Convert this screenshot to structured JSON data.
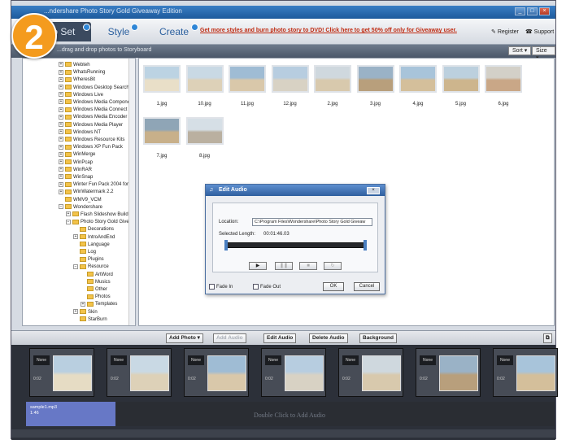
{
  "step_number": "2",
  "window": {
    "title": "...ndershare Photo Story Gold Giveaway Edition"
  },
  "nav": {
    "tabs": [
      {
        "label": "Photo Set"
      },
      {
        "label": "Style"
      },
      {
        "label": "Create"
      }
    ],
    "promo": "Get more styles and burn photo story to DVD! Click here to get 50% off only for Giveaway user.",
    "register": "Register",
    "support": "Support"
  },
  "toolbar": {
    "instruction": "...drag and drop photos to Storyboard",
    "sort": "Sort ▾",
    "size": "Size ▾"
  },
  "tree": [
    {
      "label": "Webteh",
      "level": 0,
      "exp": "+"
    },
    {
      "label": "WhatsRunning",
      "level": 0,
      "exp": "+"
    },
    {
      "label": "Wheres8it",
      "level": 0,
      "exp": "+"
    },
    {
      "label": "Windows Desktop Search",
      "level": 0,
      "exp": "+"
    },
    {
      "label": "Windows Live",
      "level": 0,
      "exp": "+"
    },
    {
      "label": "Windows Media Compone",
      "level": 0,
      "exp": "+"
    },
    {
      "label": "Windows Media Connect",
      "level": 0,
      "exp": "+"
    },
    {
      "label": "Windows Media Encoder",
      "level": 0,
      "exp": "+"
    },
    {
      "label": "Windows Media Player",
      "level": 0,
      "exp": "+"
    },
    {
      "label": "Windows NT",
      "level": 0,
      "exp": "+"
    },
    {
      "label": "Windows Resource Kits",
      "level": 0,
      "exp": "+"
    },
    {
      "label": "Windows XP Fun Pack",
      "level": 0,
      "exp": "+"
    },
    {
      "label": "WinMerge",
      "level": 0,
      "exp": "+"
    },
    {
      "label": "WinPcap",
      "level": 0,
      "exp": "+"
    },
    {
      "label": "WinRAR",
      "level": 0,
      "exp": "+"
    },
    {
      "label": "WinSnap",
      "level": 0,
      "exp": "+"
    },
    {
      "label": "Winter Fun Pack 2004 for",
      "level": 0,
      "exp": "+"
    },
    {
      "label": "WinWatermark 2.2",
      "level": 0,
      "exp": "+"
    },
    {
      "label": "WMV9_VCM",
      "level": 0,
      "exp": ""
    },
    {
      "label": "Wondershare",
      "level": 0,
      "exp": "−"
    },
    {
      "label": "Flash Slideshow Build",
      "level": 1,
      "exp": "+"
    },
    {
      "label": "Photo Story Gold Give",
      "level": 1,
      "exp": "−"
    },
    {
      "label": "Decorations",
      "level": 2,
      "exp": ""
    },
    {
      "label": "IntroAndEnd",
      "level": 2,
      "exp": "+"
    },
    {
      "label": "Language",
      "level": 2,
      "exp": ""
    },
    {
      "label": "Log",
      "level": 2,
      "exp": ""
    },
    {
      "label": "Plugins",
      "level": 2,
      "exp": ""
    },
    {
      "label": "Resource",
      "level": 2,
      "exp": "−"
    },
    {
      "label": "ArtWord",
      "level": 3,
      "exp": ""
    },
    {
      "label": "Musics",
      "level": 3,
      "exp": ""
    },
    {
      "label": "Other",
      "level": 3,
      "exp": ""
    },
    {
      "label": "Photos",
      "level": 3,
      "exp": ""
    },
    {
      "label": "Templates",
      "level": 3,
      "exp": "+"
    },
    {
      "label": "Skin",
      "level": 2,
      "exp": "+"
    },
    {
      "label": "StarBurn",
      "level": 2,
      "exp": ""
    }
  ],
  "thumbnails": [
    {
      "label": "1.jpg",
      "colors": [
        "#bcd3e3",
        "#e9dfc8"
      ]
    },
    {
      "label": "10.jpg",
      "colors": [
        "#c9d9e4",
        "#ddd1b8"
      ]
    },
    {
      "label": "11.jpg",
      "colors": [
        "#9fbcd4",
        "#d9c8aa"
      ]
    },
    {
      "label": "12.jpg",
      "colors": [
        "#b7cde0",
        "#d8d2c4"
      ]
    },
    {
      "label": "2.jpg",
      "colors": [
        "#cfd8de",
        "#d8c9ad"
      ]
    },
    {
      "label": "3.jpg",
      "colors": [
        "#9ab2c6",
        "#b89f7c"
      ]
    },
    {
      "label": "4.jpg",
      "colors": [
        "#a8c4da",
        "#d4bf9b"
      ]
    },
    {
      "label": "5.jpg",
      "colors": [
        "#bcd0de",
        "#cdb58d"
      ]
    },
    {
      "label": "6.jpg",
      "colors": [
        "#d3d0c8",
        "#c9a787"
      ]
    },
    {
      "label": "7.jpg",
      "colors": [
        "#8fa5b6",
        "#c8b08a"
      ]
    },
    {
      "label": "8.jpg",
      "colors": [
        "#d6dfe6",
        "#bab0a0"
      ]
    }
  ],
  "dialog": {
    "title": "Edit Audio",
    "location_label": "Location:",
    "location_value": "C:\\Program Files\\Wondershare\\Photo Story Gold Giveaw",
    "length_label": "Selected Length:",
    "length_value": "00:01:46.03",
    "controls": [
      "▶",
      "❚❚",
      "■",
      "↻"
    ],
    "fade_in": "Fade In",
    "fade_out": "Fade Out",
    "ok": "OK",
    "cancel": "Cancel"
  },
  "storyboard_toolbar": {
    "add_photo": "Add Photo ▾",
    "add_audio": "Add Audio",
    "edit_audio": "Edit Audio",
    "delete_audio": "Delete Audio",
    "background": "Background"
  },
  "storyboard": {
    "frames": [
      {
        "transition": "None",
        "duration": "0:02",
        "colors": [
          "#b9cfe0",
          "#e6dcc4"
        ]
      },
      {
        "transition": "None",
        "duration": "0:02",
        "colors": [
          "#c9d9e4",
          "#ddd1b8"
        ]
      },
      {
        "transition": "None",
        "duration": "0:02",
        "colors": [
          "#9fbcd4",
          "#d9c8aa"
        ]
      },
      {
        "transition": "None",
        "duration": "0:02",
        "colors": [
          "#b7cde0",
          "#d8d2c4"
        ]
      },
      {
        "transition": "None",
        "duration": "0:02",
        "colors": [
          "#cfd8de",
          "#d8c9ad"
        ]
      },
      {
        "transition": "None",
        "duration": "0:02",
        "colors": [
          "#9ab2c6",
          "#b89f7c"
        ]
      },
      {
        "transition": "None",
        "duration": "0:02",
        "colors": [
          "#a8c4da",
          "#d4bf9b"
        ]
      }
    ],
    "audio_clip": {
      "name": "sample1.mp3",
      "duration": "1:46"
    },
    "drop_hint": "Double Click to Add Audio"
  }
}
